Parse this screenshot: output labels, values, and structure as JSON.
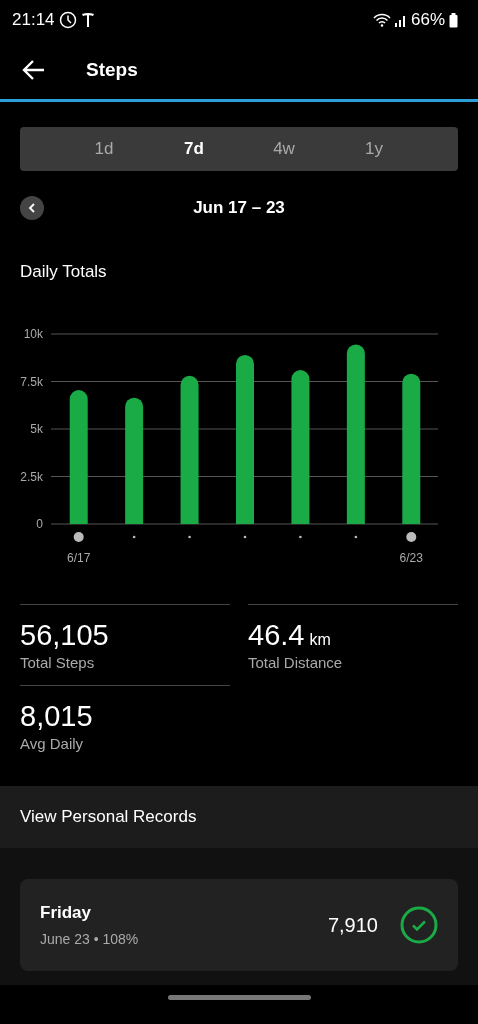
{
  "status_bar": {
    "time": "21:14",
    "battery": "66%"
  },
  "header": {
    "title": "Steps"
  },
  "tabs": [
    {
      "label": "1d",
      "selected": false
    },
    {
      "label": "7d",
      "selected": true
    },
    {
      "label": "4w",
      "selected": false
    },
    {
      "label": "1y",
      "selected": false
    }
  ],
  "date_range": "Jun 17 – 23",
  "section_title": "Daily Totals",
  "chart_data": {
    "type": "bar",
    "grid": true,
    "categories": [
      "6/17",
      null,
      null,
      null,
      null,
      null,
      "6/23"
    ],
    "values": [
      7050,
      6650,
      7800,
      8900,
      8100,
      9450,
      7910
    ],
    "ylim": [
      0,
      10000
    ],
    "yticks": [
      {
        "value": 0,
        "label": "0"
      },
      {
        "value": 2500,
        "label": "2.5k"
      },
      {
        "value": 5000,
        "label": "5k"
      },
      {
        "value": 7500,
        "label": "7.5k"
      },
      {
        "value": 10000,
        "label": "10k"
      }
    ]
  },
  "stats": [
    {
      "value": "56,105",
      "label": "Total Steps"
    },
    {
      "value": "46.4",
      "unit": "km",
      "label": "Total Distance"
    },
    {
      "value": "8,015",
      "label": "Avg Daily"
    }
  ],
  "records_link": "View Personal Records",
  "day_card": {
    "day": "Friday",
    "detail": "June 23 • 108%",
    "steps": "7,910",
    "goal_met": true
  }
}
